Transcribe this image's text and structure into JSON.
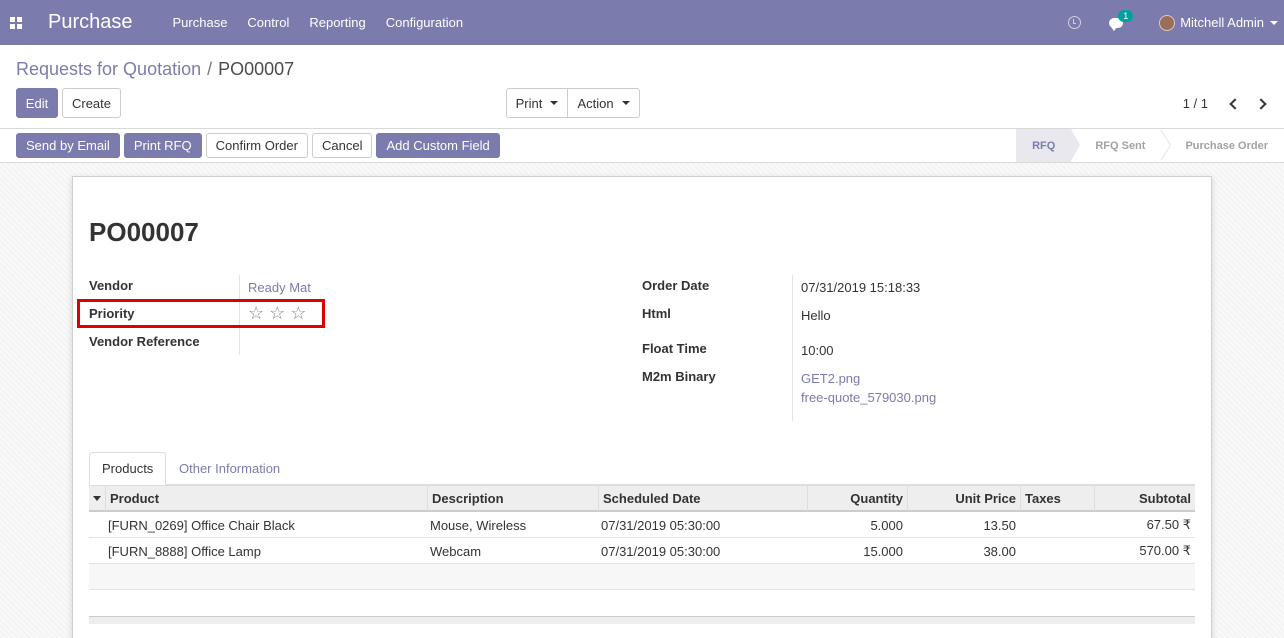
{
  "navbar": {
    "brand": "Purchase",
    "menu": [
      "Purchase",
      "Control",
      "Reporting",
      "Configuration"
    ],
    "chat_badge": "1",
    "user": "Mitchell Admin"
  },
  "breadcrumb": {
    "parent": "Requests for Quotation",
    "separator": "/",
    "current": "PO00007"
  },
  "control": {
    "edit_label": "Edit",
    "create_label": "Create",
    "print_label": "Print",
    "action_label": "Action",
    "pager": "1 / 1"
  },
  "statusbar": {
    "buttons": [
      "Send by Email",
      "Print RFQ",
      "Confirm Order",
      "Cancel",
      "Add Custom Field"
    ],
    "stages": [
      "RFQ",
      "RFQ Sent",
      "Purchase Order"
    ],
    "active_stage": "RFQ"
  },
  "form": {
    "title": "PO00007",
    "left": {
      "vendor_label": "Vendor",
      "vendor_value": "Ready Mat",
      "priority_label": "Priority",
      "priority_stars": 0,
      "priority_max": 3,
      "vendor_ref_label": "Vendor Reference"
    },
    "right": {
      "order_date_label": "Order Date",
      "order_date_value": "07/31/2019 15:18:33",
      "html_label": "Html",
      "html_value": "Hello",
      "float_time_label": "Float Time",
      "float_time_value": "10:00",
      "m2m_label": "M2m Binary",
      "m2m_files": [
        "GET2.png",
        "free-quote_579030.png"
      ]
    }
  },
  "tabs": [
    "Products",
    "Other Information"
  ],
  "table": {
    "columns": [
      "Product",
      "Description",
      "Scheduled Date",
      "Quantity",
      "Unit Price",
      "Taxes",
      "Subtotal"
    ],
    "rows": [
      {
        "product": "[FURN_0269] Office Chair Black",
        "description": "Mouse, Wireless",
        "date": "07/31/2019 05:30:00",
        "qty": "5.000",
        "price": "13.50",
        "taxes": "",
        "subtotal": "67.50 ₹"
      },
      {
        "product": "[FURN_8888] Office Lamp",
        "description": "Webcam",
        "date": "07/31/2019 05:30:00",
        "qty": "15.000",
        "price": "38.00",
        "taxes": "",
        "subtotal": "570.00 ₹"
      }
    ]
  },
  "colors": {
    "brand": "#7c7bad",
    "highlight": "#e00000"
  }
}
